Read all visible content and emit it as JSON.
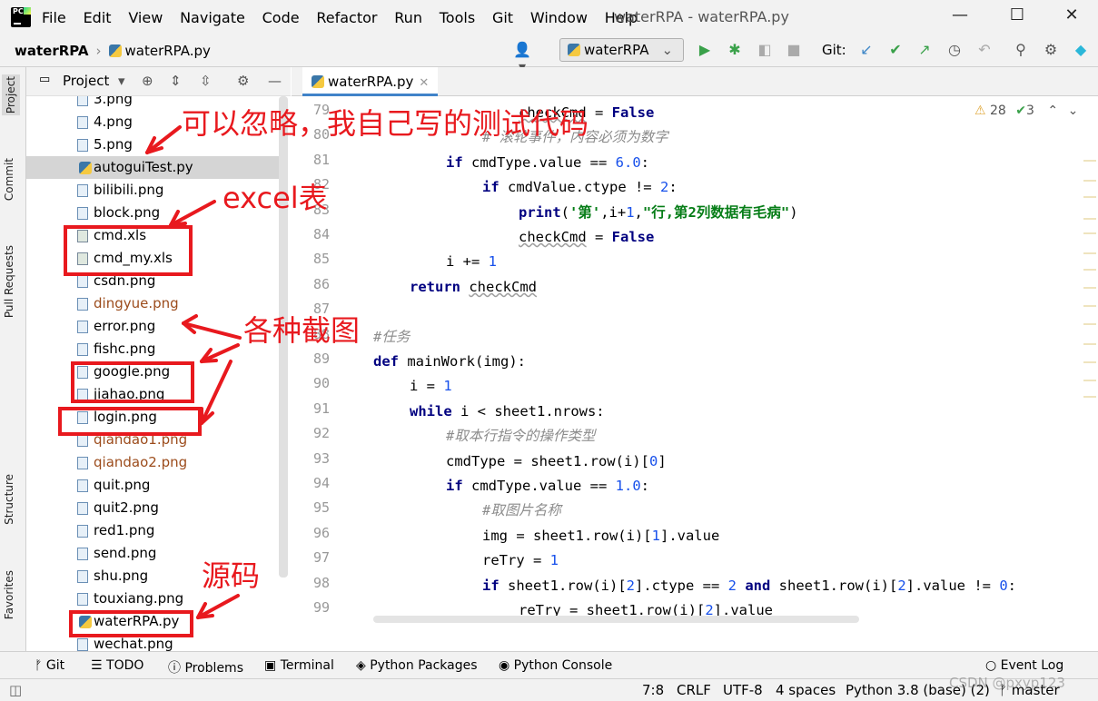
{
  "menu": [
    "File",
    "Edit",
    "View",
    "Navigate",
    "Code",
    "Refactor",
    "Run",
    "Tools",
    "Git",
    "Window",
    "Help"
  ],
  "window_title": "waterRPA - waterRPA.py",
  "breadcrumb": {
    "project": "waterRPA",
    "file": "waterRPA.py"
  },
  "run_config": "waterRPA",
  "git_label": "Git:",
  "side_tools": [
    "Project",
    "Commit",
    "Pull Requests",
    "Structure",
    "Favorites"
  ],
  "project_panel": {
    "title": "Project"
  },
  "tree": [
    {
      "name": "3.png",
      "status": "normal"
    },
    {
      "name": "4.png",
      "status": "normal"
    },
    {
      "name": "5.png",
      "status": "normal"
    },
    {
      "name": "autoguiTest.py",
      "status": "normal",
      "selected": true
    },
    {
      "name": "bilibili.png",
      "status": "normal"
    },
    {
      "name": "block.png",
      "status": "normal"
    },
    {
      "name": "cmd.xls",
      "status": "normal"
    },
    {
      "name": "cmd_my.xls",
      "status": "normal"
    },
    {
      "name": "csdn.png",
      "status": "normal"
    },
    {
      "name": "dingyue.png",
      "status": "modified"
    },
    {
      "name": "error.png",
      "status": "normal"
    },
    {
      "name": "fishc.png",
      "status": "normal"
    },
    {
      "name": "google.png",
      "status": "normal"
    },
    {
      "name": "jiahao.png",
      "status": "normal"
    },
    {
      "name": "login.png",
      "status": "normal"
    },
    {
      "name": "qiandao1.png",
      "status": "modified"
    },
    {
      "name": "qiandao2.png",
      "status": "modified"
    },
    {
      "name": "quit.png",
      "status": "normal"
    },
    {
      "name": "quit2.png",
      "status": "normal"
    },
    {
      "name": "red1.png",
      "status": "normal"
    },
    {
      "name": "send.png",
      "status": "normal"
    },
    {
      "name": "shu.png",
      "status": "normal"
    },
    {
      "name": "touxiang.png",
      "status": "normal"
    },
    {
      "name": "waterRPA.py",
      "status": "normal"
    },
    {
      "name": "wechat.png",
      "status": "normal"
    }
  ],
  "editor_tab": "waterRPA.py",
  "inspections": {
    "warnings": "28",
    "ok": "3"
  },
  "line_numbers": [
    "79",
    "80",
    "81",
    "82",
    "83",
    "84",
    "85",
    "86",
    "87",
    "88",
    "89",
    "90",
    "91",
    "92",
    "93",
    "94",
    "95",
    "96",
    "97",
    "98",
    "99"
  ],
  "code_lines": [
    "checkCmd = False",
    "# 滚轮事件，内容必须为数字",
    "if cmdType.value == 6.0:",
    "if cmdValue.ctype != 2:",
    "print('第',i+1,\"行,第2列数据有毛病\")",
    "checkCmd = False",
    "i += 1",
    "return checkCmd",
    "",
    "#任务",
    "def mainWork(img):",
    "i = 1",
    "while i < sheet1.nrows:",
    "#取本行指令的操作类型",
    "cmdType = sheet1.row(i)[0]",
    "if cmdType.value == 1.0:",
    "#取图片名称",
    "img = sheet1.row(i)[1].value",
    "reTry = 1",
    "if sheet1.row(i)[2].ctype == 2 and sheet1.row(i)[2].value != 0:",
    "reTry = sheet1.row(i)[2].value"
  ],
  "annotations": {
    "ignore": "可以忽略，我自己写的测试代码",
    "excel": "excel表",
    "screenshots": "各种截图",
    "source": "源码"
  },
  "tool_windows": [
    "Git",
    "TODO",
    "Problems",
    "Terminal",
    "Python Packages",
    "Python Console",
    "Event Log"
  ],
  "status": {
    "position": "7:8",
    "line_sep": "CRLF",
    "encoding": "UTF-8",
    "indent": "4 spaces",
    "interpreter": "Python 3.8 (base) (2)",
    "branch": "master",
    "watermark": "CSDN @pxyp123"
  }
}
